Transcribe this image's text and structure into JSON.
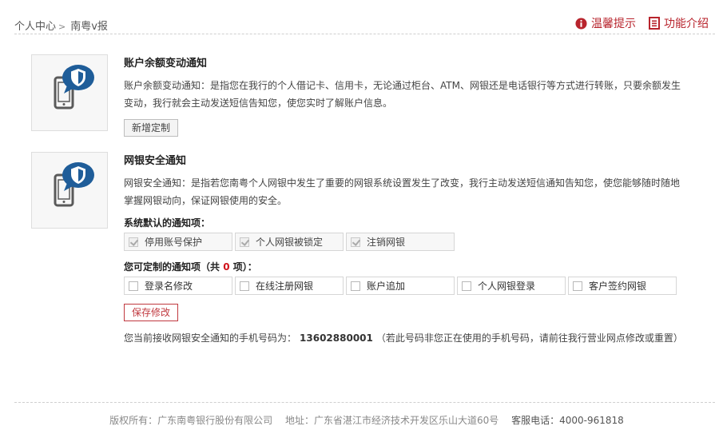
{
  "breadcrumb": {
    "home": "个人中心",
    "separator": ">",
    "current": "南粤v报"
  },
  "header_links": [
    {
      "label": "温馨提示",
      "icon": "info-icon"
    },
    {
      "label": "功能介绍",
      "icon": "document-icon"
    }
  ],
  "colors": {
    "accent_red": "#b8242d",
    "icon_blue": "#1f5d99"
  },
  "balance_section": {
    "title": "账户余额变动通知",
    "description": "账户余额变动通知：是指您在我行的个人借记卡、信用卡，无论通过柜台、ATM、网银还是电话银行等方式进行转账，只要余额发生变动，我行就会主动发送短信告知您，使您实时了解账户信息。",
    "button": "新增定制"
  },
  "security_section": {
    "title": "网银安全通知",
    "description": "网银安全通知：是指若您南粤个人网银中发生了重要的网银系统设置发生了改变，我行主动发送短信通知告知您，使您能够随时随地掌握网银动向，保证网银使用的安全。",
    "default_label": "系统默认的通知项：",
    "default_items": [
      "停用账号保护",
      "个人网银被锁定",
      "注销网银"
    ],
    "custom_label_prefix": "您可定制的通知项（共",
    "custom_count": "0",
    "custom_label_suffix": "项）：",
    "custom_items": [
      "登录名修改",
      "在线注册网银",
      "账户追加",
      "个人网银登录",
      "客户签约网银"
    ],
    "save_button": "保存修改",
    "phone_prefix": "您当前接收网银安全通知的手机号码为：",
    "phone_number": "13602880001",
    "phone_suffix": "（若此号码非您正在使用的手机号码，请前往我行营业网点修改或重置）"
  },
  "footer": {
    "copyright": "版权所有：广东南粤银行股份有限公司",
    "address": "地址：广东省湛江市经济技术开发区乐山大道60号",
    "hotline": "客服电话：4000-961818"
  }
}
